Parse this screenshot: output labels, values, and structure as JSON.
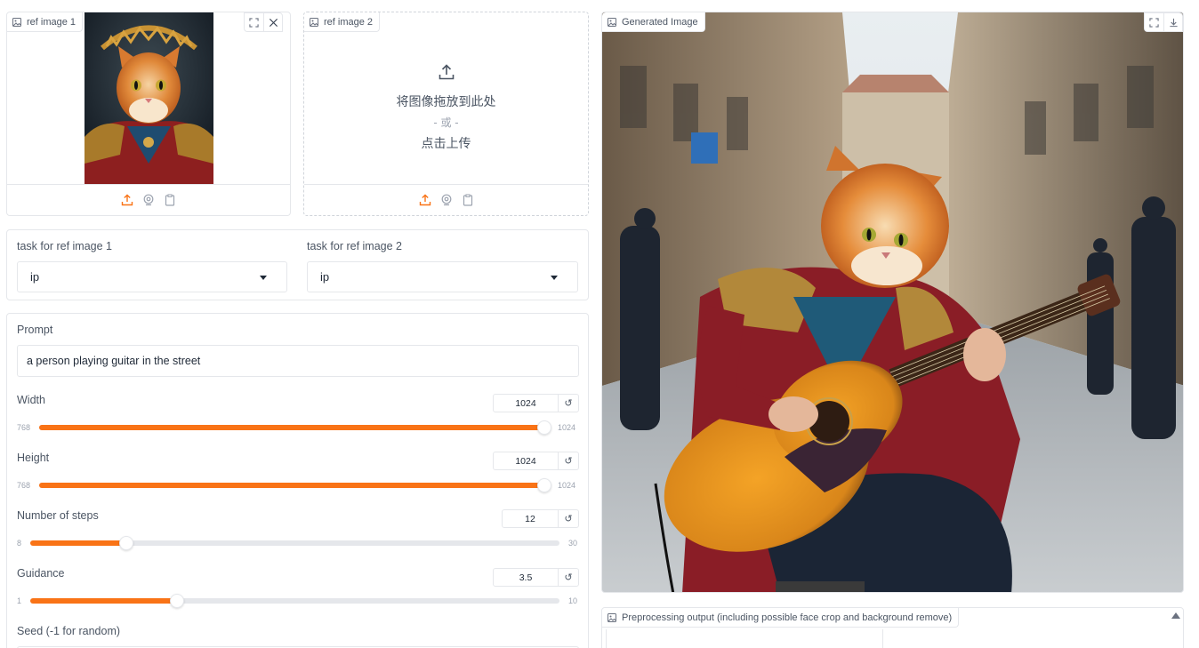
{
  "accent_color": "#f97316",
  "ref_image_1": {
    "label": "ref image 1",
    "fullscreen_icon": "fullscreen-icon",
    "clear_icon": "close-icon",
    "sources": [
      "upload-icon",
      "webcam-icon",
      "clipboard-icon"
    ]
  },
  "ref_image_2": {
    "label": "ref image 2",
    "drop_text": "将图像拖放到此处",
    "or_text": "- 或 -",
    "click_text": "点击上传",
    "sources": [
      "upload-icon",
      "webcam-icon",
      "clipboard-icon"
    ]
  },
  "tasks": {
    "task1_label": "task for ref image 1",
    "task1_value": "ip",
    "task2_label": "task for ref image 2",
    "task2_value": "ip"
  },
  "prompt": {
    "label": "Prompt",
    "value": "a person playing guitar in the street"
  },
  "sliders": {
    "width": {
      "label": "Width",
      "value": "1024",
      "min": "768",
      "max": "1024",
      "fraction": 1.0
    },
    "height": {
      "label": "Height",
      "value": "1024",
      "min": "768",
      "max": "1024",
      "fraction": 1.0
    },
    "steps": {
      "label": "Number of steps",
      "value": "12",
      "min": "8",
      "max": "30",
      "fraction": 0.1818
    },
    "guidance": {
      "label": "Guidance",
      "value": "3.5",
      "min": "1",
      "max": "10",
      "fraction": 0.2778
    }
  },
  "seed": {
    "label": "Seed (-1 for random)"
  },
  "reset_glyph": "↺",
  "generated": {
    "label": "Generated Image",
    "fullscreen_icon": "fullscreen-icon",
    "download_icon": "download-icon"
  },
  "preprocess": {
    "label": "Preprocessing output (including possible face crop and background remove)"
  }
}
